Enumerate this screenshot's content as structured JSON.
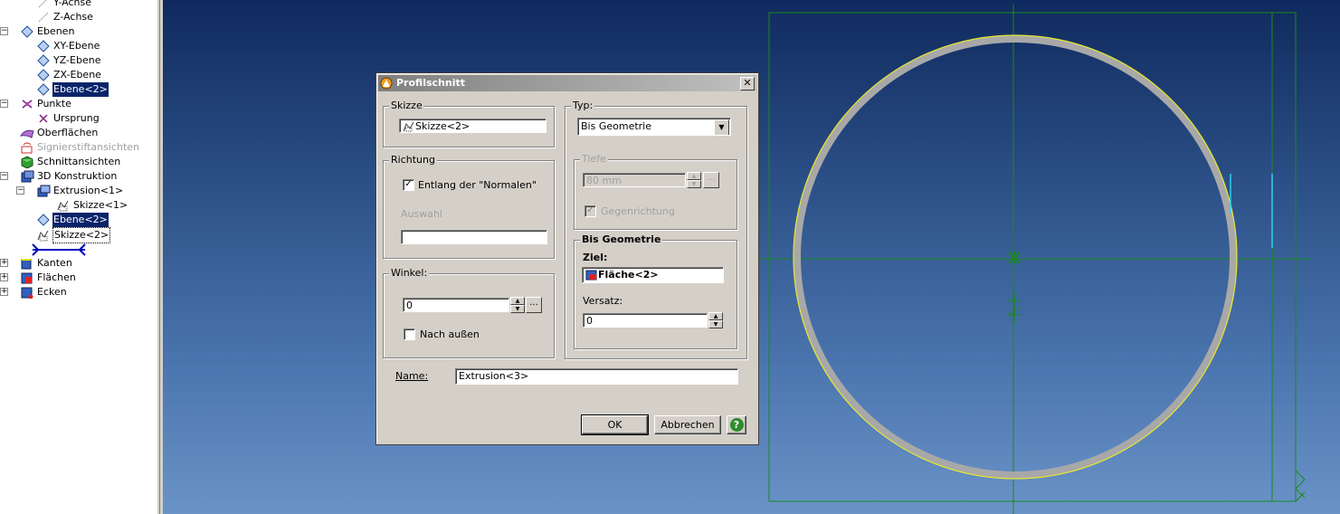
{
  "tree": {
    "items": [
      {
        "label": "Y-Achse",
        "icon": "axis-icon"
      },
      {
        "label": "Z-Achse",
        "icon": "axis-icon"
      },
      {
        "label": "Ebenen",
        "icon": "planes-icon"
      },
      {
        "label": "XY-Ebene",
        "icon": "plane-icon"
      },
      {
        "label": "YZ-Ebene",
        "icon": "plane-icon"
      },
      {
        "label": "ZX-Ebene",
        "icon": "plane-icon"
      },
      {
        "label": "Ebene<2>",
        "icon": "plane-icon"
      },
      {
        "label": "Punkte",
        "icon": "points-icon"
      },
      {
        "label": "Ursprung",
        "icon": "origin-icon"
      },
      {
        "label": "Oberflächen",
        "icon": "surfaces-icon"
      },
      {
        "label": "Signierstiftansichten",
        "icon": "markup-icon"
      },
      {
        "label": "Schnittansichten",
        "icon": "section-icon"
      },
      {
        "label": "3D Konstruktion",
        "icon": "construction-icon"
      },
      {
        "label": "Extrusion<1>",
        "icon": "extrusion-icon"
      },
      {
        "label": "Skizze<1>",
        "icon": "sketch-icon"
      },
      {
        "label": "Ebene<2>",
        "icon": "plane-icon"
      },
      {
        "label": "Skizze<2>",
        "icon": "sketch-icon"
      },
      {
        "label": "Kanten",
        "icon": "edges-icon"
      },
      {
        "label": "Flächen",
        "icon": "faces-icon"
      },
      {
        "label": "Ecken",
        "icon": "vertices-icon"
      }
    ],
    "expand_minus": "−",
    "expand_plus": "+"
  },
  "dialog": {
    "title": "Profilschnitt",
    "close": "✕",
    "skizze": {
      "group": "Skizze",
      "value": "Skizze<2>"
    },
    "richtung": {
      "group": "Richtung",
      "normal_label": "Entlang der \"Normalen\"",
      "normal_checked": "✓",
      "auswahl_label": "Auswahl",
      "auswahl_value": ""
    },
    "winkel": {
      "group": "Winkel:",
      "value": "0",
      "outward_label": "Nach außen",
      "outward_checked": ""
    },
    "typ": {
      "group": "Typ:",
      "value": "Bis Geometrie",
      "arrow": "▼"
    },
    "tiefe": {
      "group": "Tiefe",
      "value": "80 mm",
      "reverse_label": "Gegenrichtung",
      "reverse_checked": "✓"
    },
    "bis_geometrie": {
      "group": "Bis Geometrie",
      "ziel_label": "Ziel:",
      "ziel_value": "Fläche<2>",
      "versatz_label": "Versatz:",
      "versatz_value": "0"
    },
    "name": {
      "label": "Name:",
      "value": "Extrusion<3>"
    },
    "ok": "OK",
    "cancel": "Abbrechen",
    "help": "?",
    "spin_up": "▲",
    "spin_down": "▼",
    "dots": "..."
  },
  "colors": {
    "selection": "#0a246a",
    "viewport_top": "#0f2a5e",
    "viewport_bottom": "#6a93c8",
    "sketch_green": "#1a8a1a",
    "profile_yellow": "#e8e830",
    "profile_gray": "#a8a8a8",
    "help_green": "#2e8b2e"
  }
}
